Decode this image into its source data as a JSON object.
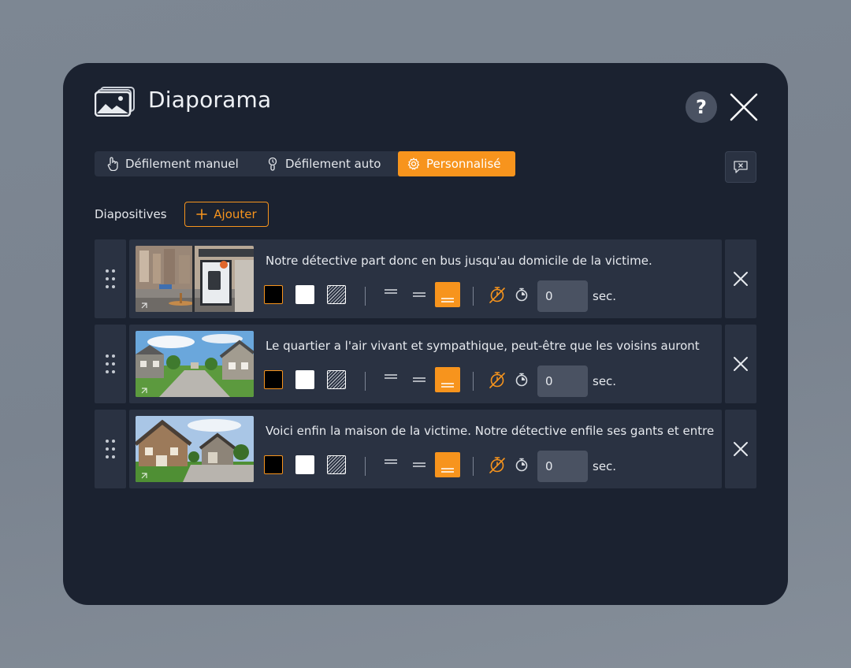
{
  "dialog": {
    "title": "Diaporama",
    "help_label": "?",
    "modes": [
      {
        "label": "Défilement manuel",
        "active": false
      },
      {
        "label": "Défilement auto",
        "active": false
      },
      {
        "label": "Personnalisé",
        "active": true
      }
    ],
    "slides_label": "Diapositives",
    "add_label": "Ajouter",
    "sec_unit": "sec.",
    "accent_color": "#f7941d",
    "slides": [
      {
        "caption": "Notre détective part donc en bus jusqu'au domicile de la victime.",
        "seconds": "0",
        "thumb": "bus-stop"
      },
      {
        "caption": "Le quartier a l'air vivant et sympathique, peut-être que les voisins auront",
        "seconds": "0",
        "thumb": "street"
      },
      {
        "caption": "Voici enfin la maison de la victime. Notre détective enfile ses gants et entre",
        "seconds": "0",
        "thumb": "house"
      }
    ]
  }
}
